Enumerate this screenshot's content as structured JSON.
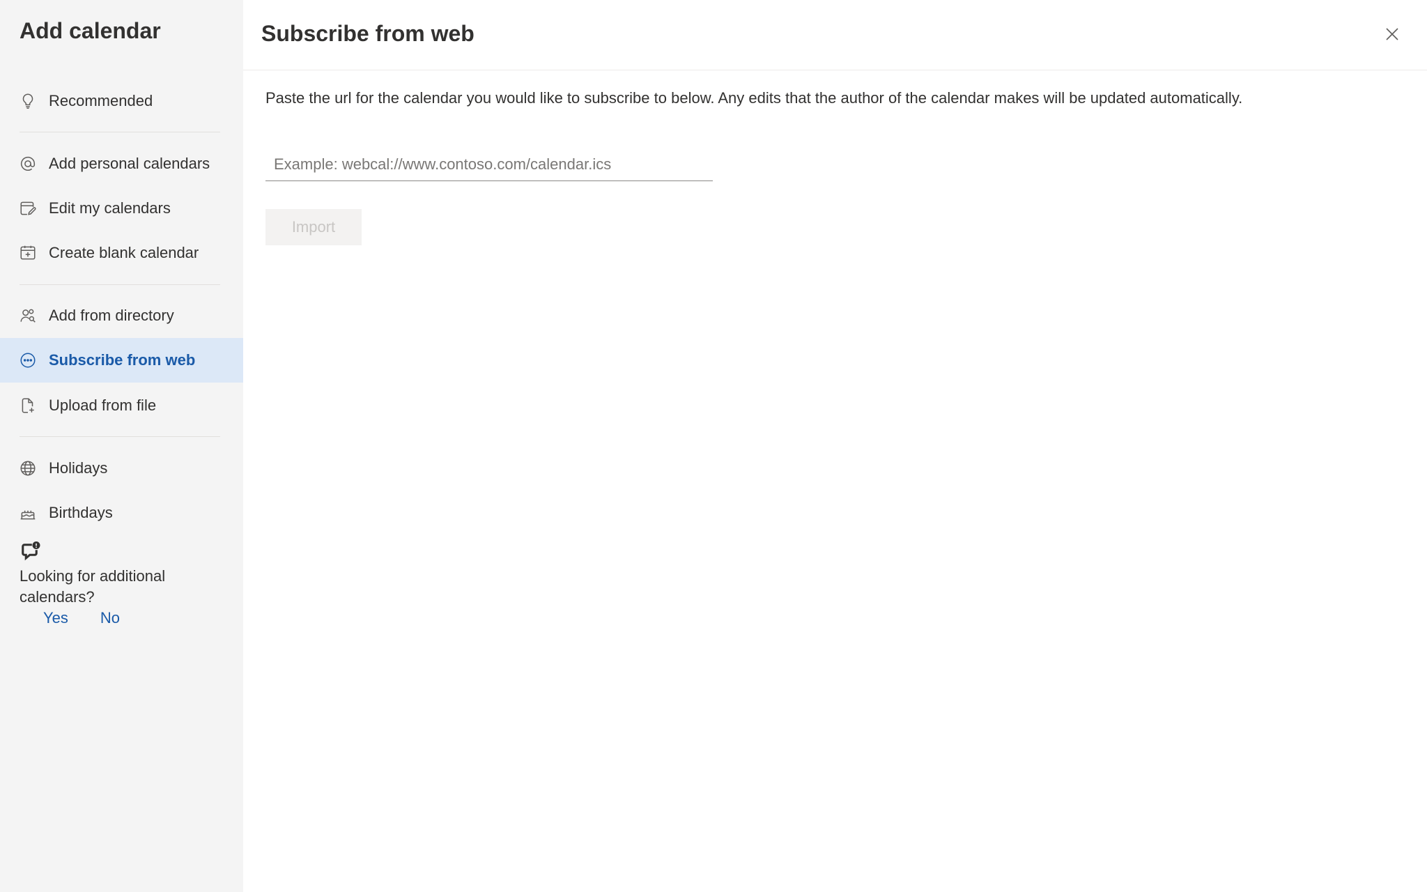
{
  "sidebar": {
    "title": "Add calendar",
    "items": [
      {
        "label": "Recommended",
        "icon": "lightbulb-icon"
      },
      {
        "label": "Add personal calendars",
        "icon": "at-sign-icon"
      },
      {
        "label": "Edit my calendars",
        "icon": "calendar-edit-icon"
      },
      {
        "label": "Create blank calendar",
        "icon": "calendar-add-icon"
      },
      {
        "label": "Add from directory",
        "icon": "people-search-icon"
      },
      {
        "label": "Subscribe from web",
        "icon": "more-circle-icon",
        "selected": true
      },
      {
        "label": "Upload from file",
        "icon": "document-add-icon"
      },
      {
        "label": "Holidays",
        "icon": "globe-icon"
      },
      {
        "label": "Birthdays",
        "icon": "cake-icon"
      }
    ],
    "feedback": {
      "icon": "chat-alert-icon",
      "question": "Looking for additional calendars?",
      "yes_label": "Yes",
      "no_label": "No"
    }
  },
  "main": {
    "title": "Subscribe from web",
    "description": "Paste the url for the calendar you would like to subscribe to below. Any edits that the author of the calendar makes will be updated automatically.",
    "url_input": {
      "value": "",
      "placeholder": "Example: webcal://www.contoso.com/calendar.ics"
    },
    "import_label": "Import",
    "close_icon": "close-icon"
  },
  "colors": {
    "accent": "#1a5aa8",
    "selected_bg": "#dce8f7",
    "sidebar_bg": "#f4f4f4"
  }
}
